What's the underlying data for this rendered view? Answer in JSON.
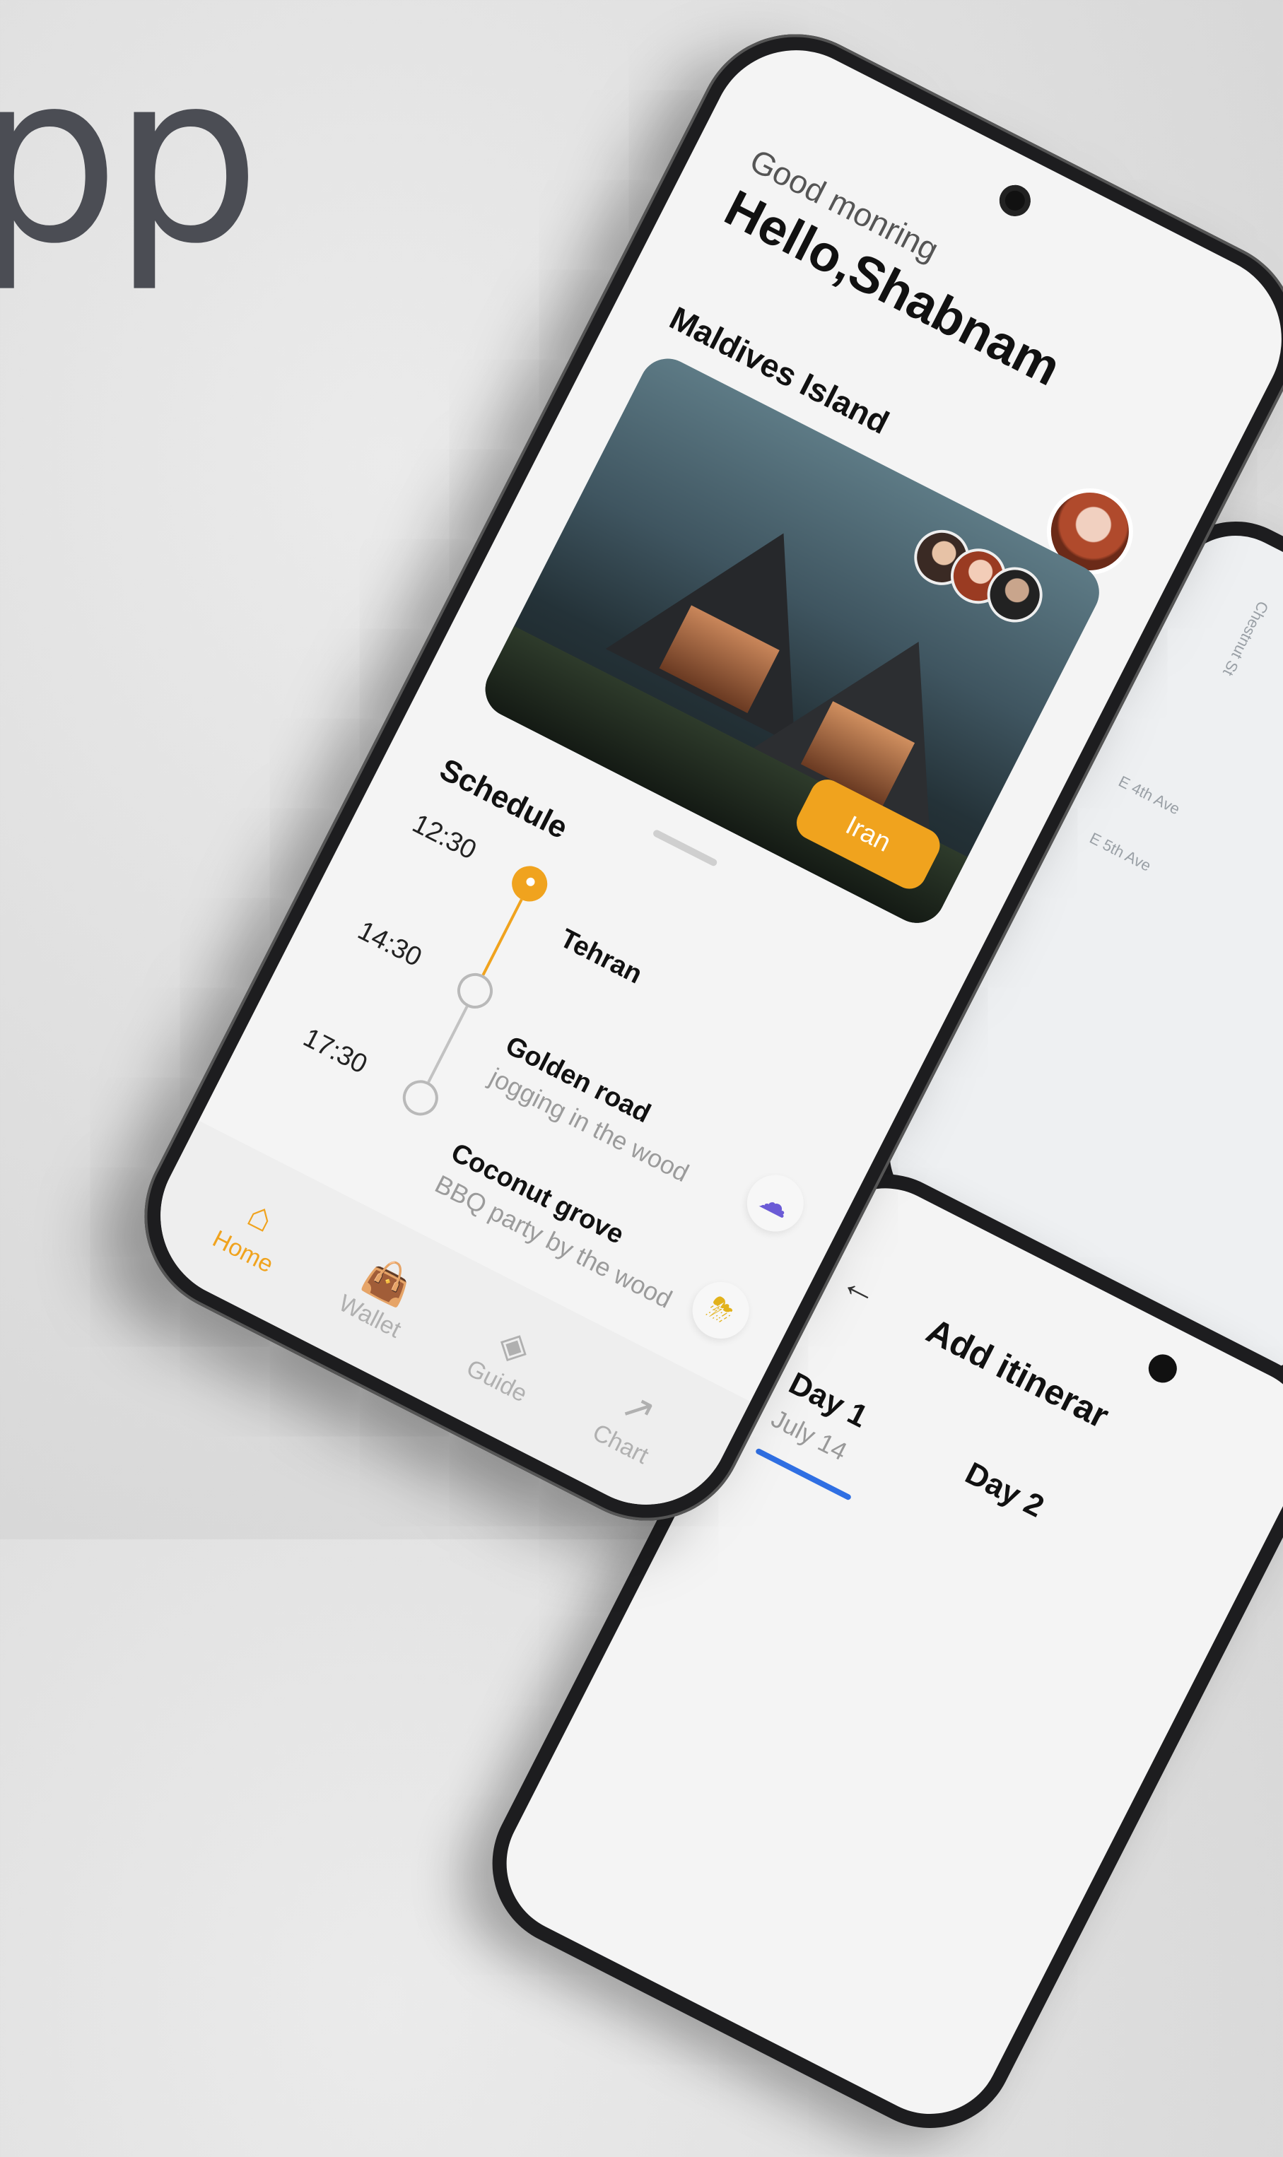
{
  "brand": {
    "text": "pp"
  },
  "home": {
    "greeting": "Good monring",
    "hello": "Hello,Shabnam",
    "card_title": "Maldives Island",
    "tag_button": "Iran",
    "schedule_title": "Schedule",
    "schedule": [
      {
        "time": "12:30",
        "place": "Tehran",
        "note": "",
        "active": true
      },
      {
        "time": "14:30",
        "place": "Golden road",
        "note": "jogging in the wood",
        "active": false
      },
      {
        "time": "17:30",
        "place": "Coconut grove",
        "note": "BBQ party by the wood",
        "active": false
      }
    ],
    "nav": [
      {
        "label": "Home",
        "icon": "home-icon",
        "active": true
      },
      {
        "label": "Wallet",
        "icon": "wallet-icon",
        "active": false
      },
      {
        "label": "Guide",
        "icon": "compass-icon",
        "active": false
      },
      {
        "label": "Chart",
        "icon": "chart-icon",
        "active": false
      }
    ],
    "accent_color": "#f0a31e"
  },
  "itinerary": {
    "title": "Add itinerar",
    "day1": "Day 1",
    "day1_date": "July 14",
    "day2": "Day 2",
    "tab_color": "#2f6fe3"
  },
  "map": {
    "street1": "Chestnut St",
    "street2": "E 4th Ave",
    "street3": "E 5th Ave"
  }
}
